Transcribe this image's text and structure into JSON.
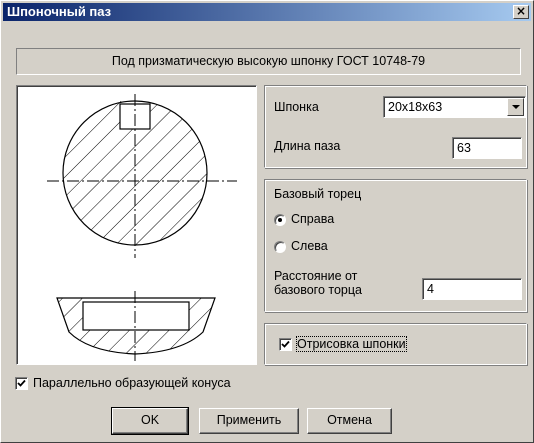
{
  "window": {
    "title": "Шпоночный паз",
    "close_glyph": "×"
  },
  "header": {
    "text": "Под призматическую высокую шпонку ГОСТ 10748-79"
  },
  "key_group": {
    "key_label": "Шпонка",
    "key_value": "20x18x63",
    "length_label": "Длина паза",
    "length_value": "63"
  },
  "base_group": {
    "title": "Базовый торец",
    "options": [
      "Справа",
      "Слева"
    ],
    "selected": "Справа",
    "distance_label_line1": "Расстояние от",
    "distance_label_line2": "базового торца",
    "distance_value": "4"
  },
  "draw_key": {
    "label": "Отрисовка шпонки",
    "checked": true
  },
  "parallel": {
    "label": "Параллельно образующей конуса",
    "checked": true
  },
  "buttons": {
    "ok": "OK",
    "apply": "Применить",
    "cancel": "Отмена"
  },
  "icons": {
    "close": "close-icon",
    "dropdown": "chevron-down-icon",
    "check": "checkmark-icon"
  },
  "colors": {
    "face": "#d4d0c8",
    "title_start": "#0a246a",
    "title_end": "#a6caf0"
  }
}
